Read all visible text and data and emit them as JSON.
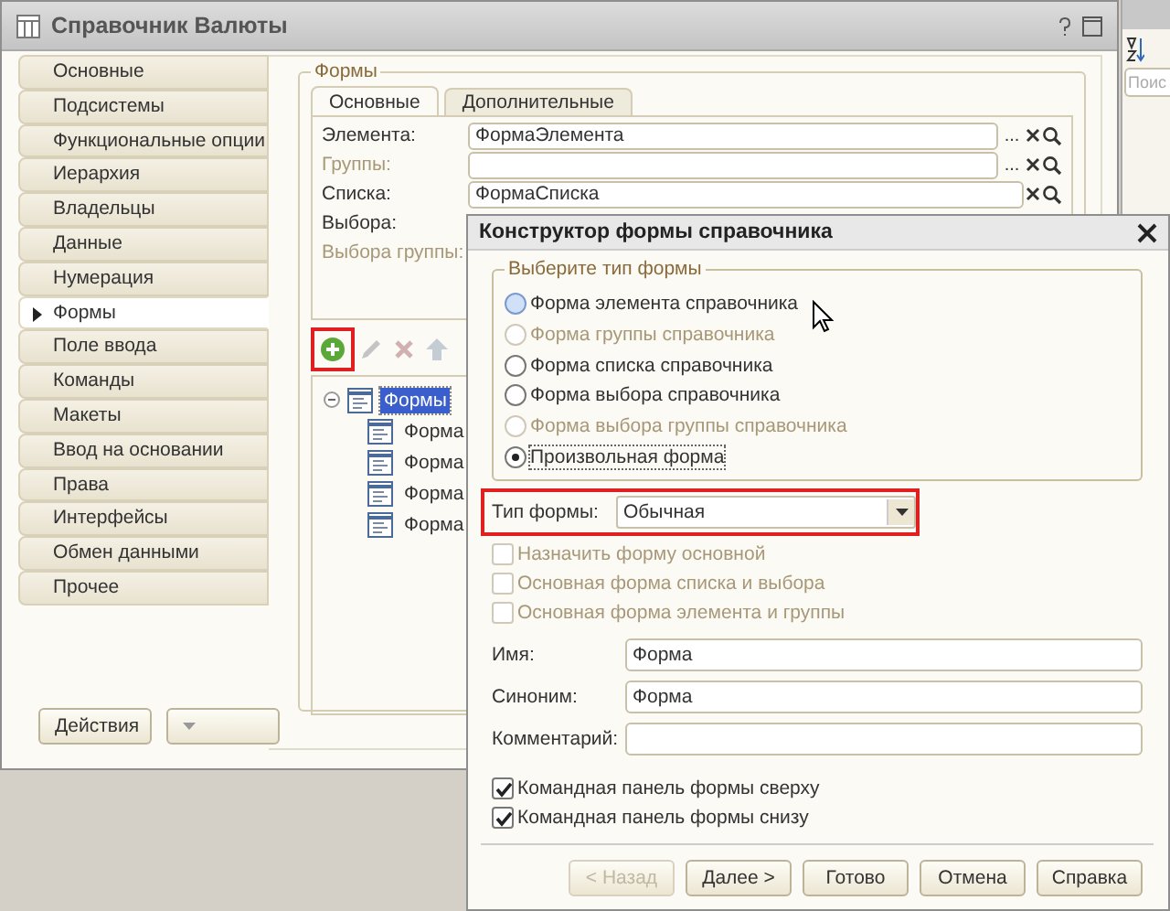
{
  "main_window": {
    "title": "Справочник Валюты",
    "sections": [
      {
        "label": "Основные",
        "selected": false
      },
      {
        "label": "Подсистемы",
        "selected": false
      },
      {
        "label": "Функциональные опции",
        "selected": false
      },
      {
        "label": "Иерархия",
        "selected": false
      },
      {
        "label": "Владельцы",
        "selected": false
      },
      {
        "label": "Данные",
        "selected": false
      },
      {
        "label": "Нумерация",
        "selected": false
      },
      {
        "label": "Формы",
        "selected": true
      },
      {
        "label": "Поле ввода",
        "selected": false
      },
      {
        "label": "Команды",
        "selected": false
      },
      {
        "label": "Макеты",
        "selected": false
      },
      {
        "label": "Ввод на основании",
        "selected": false
      },
      {
        "label": "Права",
        "selected": false
      },
      {
        "label": "Интерфейсы",
        "selected": false
      },
      {
        "label": "Обмен данными",
        "selected": false
      },
      {
        "label": "Прочее",
        "selected": false
      }
    ],
    "forms_group": {
      "title": "Формы",
      "tabs": [
        {
          "label": "Основные",
          "selected": true
        },
        {
          "label": "Дополнительные",
          "selected": false
        }
      ],
      "fields": [
        {
          "label": "Элемента:",
          "value": "ФормаЭлемента",
          "disabled": false,
          "choice_button": "..."
        },
        {
          "label": "Группы:",
          "disabled": true,
          "choice_button": "..."
        },
        {
          "label": "Списка:",
          "value": "ФормаСписка",
          "disabled": false
        },
        {
          "label": "Выбора:",
          "disabled": false
        },
        {
          "label": "Выбора группы:",
          "disabled": true
        }
      ],
      "toolbar": [
        {
          "kind": "add",
          "disabled": false,
          "highlighted": true
        },
        {
          "kind": "edit",
          "disabled": true,
          "highlighted": false
        },
        {
          "kind": "delete",
          "disabled": true,
          "highlighted": false
        },
        {
          "kind": "up",
          "disabled": true,
          "highlighted": false
        }
      ],
      "tree": {
        "label": "Формы",
        "expanded": true,
        "selected": true,
        "children": [
          {
            "label": "Форма"
          },
          {
            "label": "Форма"
          },
          {
            "label": "Форма"
          },
          {
            "label": "Форма"
          }
        ]
      }
    },
    "buttons": [
      {
        "label": "Действия",
        "kind": "menu"
      },
      {
        "kind": "menu"
      }
    ]
  },
  "dialog": {
    "title": "Конструктор формы справочника",
    "form_type_group": {
      "title": "Выберите тип формы",
      "options": [
        {
          "label": "Форма элемента справочника",
          "selected": false,
          "disabled": false,
          "hovered": true
        },
        {
          "label": "Форма группы справочника",
          "selected": false,
          "disabled": true
        },
        {
          "label": "Форма списка справочника",
          "selected": false,
          "disabled": false
        },
        {
          "label": "Форма выбора справочника",
          "selected": false,
          "disabled": false
        },
        {
          "label": "Форма выбора группы справочника",
          "selected": false,
          "disabled": true
        },
        {
          "label": "Произвольная форма",
          "selected": true,
          "disabled": false
        }
      ]
    },
    "form_kind": {
      "label": "Тип формы:",
      "value": "Обычная",
      "highlighted": true
    },
    "options": [
      {
        "label": "Назначить форму основной",
        "checked": false,
        "disabled": true
      },
      {
        "label": "Основная форма списка и выбора",
        "checked": false,
        "disabled": true
      },
      {
        "label": "Основная форма элемента и группы",
        "checked": false,
        "disabled": true
      }
    ],
    "fields": [
      {
        "label": "Имя:",
        "value": "Форма"
      },
      {
        "label": "Синоним:",
        "value": "Форма"
      },
      {
        "label": "Комментарий:"
      }
    ],
    "panel_options": [
      {
        "label": "Командная панель формы сверху",
        "checked": true,
        "disabled": false
      },
      {
        "label": "Командная панель формы снизу",
        "checked": true,
        "disabled": false
      }
    ],
    "buttons": [
      {
        "label": "< Назад",
        "disabled": true
      },
      {
        "label": "Далее >",
        "disabled": false
      },
      {
        "label": "Готово",
        "disabled": false
      },
      {
        "label": "Отмена",
        "disabled": false
      },
      {
        "label": "Справка",
        "disabled": false
      }
    ]
  },
  "side_panel": {
    "search": {
      "placeholder": "Поис"
    }
  }
}
